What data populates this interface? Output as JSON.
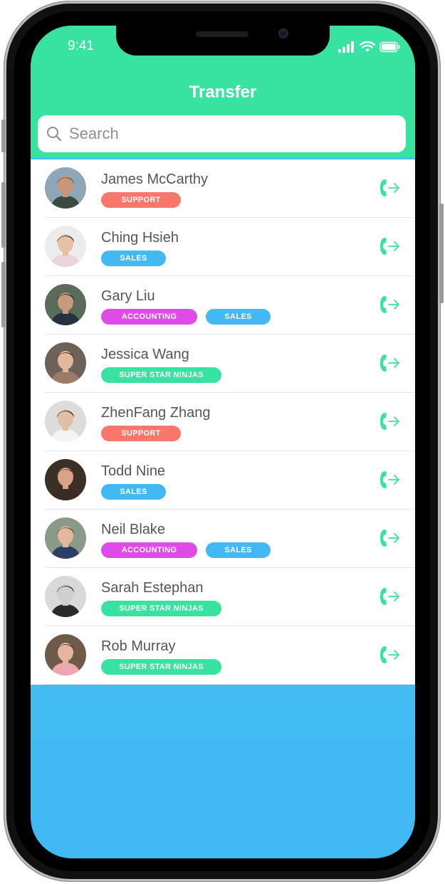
{
  "status": {
    "time": "9:41"
  },
  "header": {
    "title": "Transfer"
  },
  "search": {
    "placeholder": "Search"
  },
  "colors": {
    "accent": "#37e39e",
    "support": "#f7786b",
    "sales": "#42b9f2",
    "accounting": "#e04ae8",
    "ninjas": "#37e39e",
    "background": "#42b9f2"
  },
  "contacts": [
    {
      "name": "James McCarthy",
      "tags": [
        {
          "label": "SUPPORT",
          "type": "support"
        }
      ]
    },
    {
      "name": "Ching Hsieh",
      "tags": [
        {
          "label": "SALES",
          "type": "sales"
        }
      ]
    },
    {
      "name": "Gary Liu",
      "tags": [
        {
          "label": "ACCOUNTING",
          "type": "accounting"
        },
        {
          "label": "SALES",
          "type": "sales"
        }
      ]
    },
    {
      "name": "Jessica Wang",
      "tags": [
        {
          "label": "SUPER STAR NINJAS",
          "type": "ninjas"
        }
      ]
    },
    {
      "name": "ZhenFang Zhang",
      "tags": [
        {
          "label": "SUPPORT",
          "type": "support"
        }
      ]
    },
    {
      "name": "Todd Nine",
      "tags": [
        {
          "label": "SALES",
          "type": "sales"
        }
      ]
    },
    {
      "name": "Neil Blake",
      "tags": [
        {
          "label": "ACCOUNTING",
          "type": "accounting"
        },
        {
          "label": "SALES",
          "type": "sales"
        }
      ]
    },
    {
      "name": "Sarah Estephan",
      "tags": [
        {
          "label": "SUPER STAR NINJAS",
          "type": "ninjas"
        }
      ]
    },
    {
      "name": "Rob Murray",
      "tags": [
        {
          "label": "SUPER STAR NINJAS",
          "type": "ninjas"
        }
      ]
    }
  ],
  "icons": {
    "search": "search-icon",
    "transfer": "phone-transfer-icon",
    "signal": "cellular-signal-icon",
    "wifi": "wifi-icon",
    "battery": "battery-icon"
  }
}
